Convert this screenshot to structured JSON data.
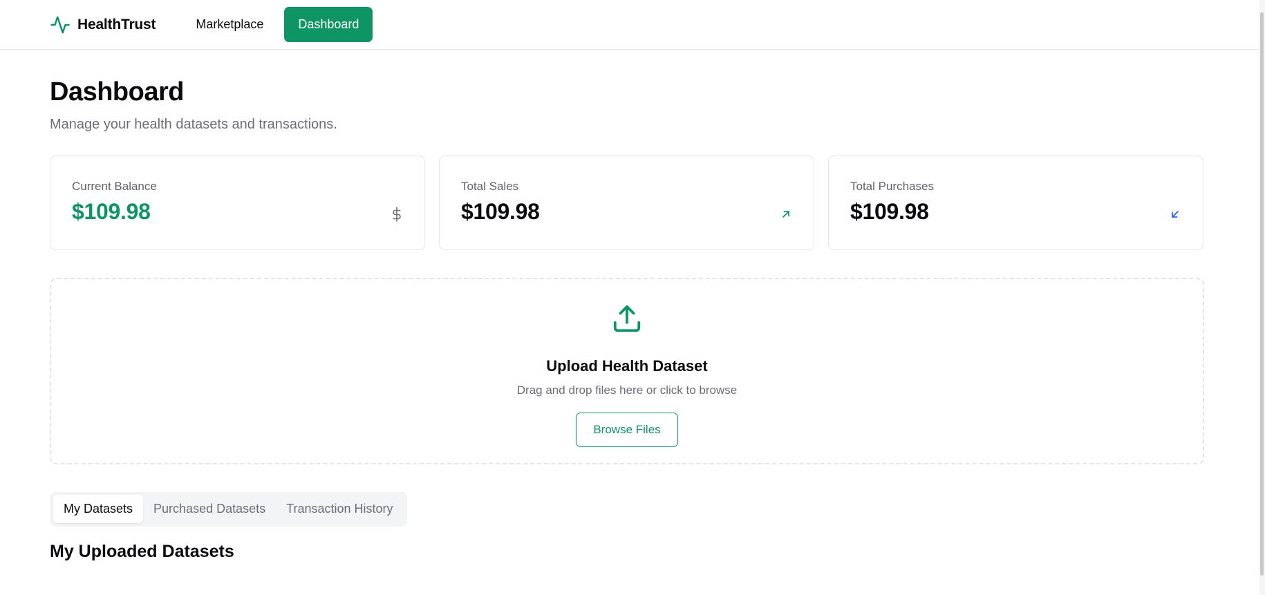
{
  "header": {
    "brand_name": "HealthTrust",
    "nav": [
      {
        "label": "Marketplace",
        "active": false
      },
      {
        "label": "Dashboard",
        "active": true
      }
    ]
  },
  "page": {
    "title": "Dashboard",
    "subtitle": "Manage your health datasets and transactions."
  },
  "stats": [
    {
      "label": "Current Balance",
      "value": "$109.98",
      "icon": "dollar-icon",
      "value_color": "#0f9466"
    },
    {
      "label": "Total Sales",
      "value": "$109.98",
      "icon": "arrow-up-right-icon",
      "icon_color": "#0f9466"
    },
    {
      "label": "Total Purchases",
      "value": "$109.98",
      "icon": "arrow-down-left-icon",
      "icon_color": "#2563eb"
    }
  ],
  "upload": {
    "title": "Upload Health Dataset",
    "hint": "Drag and drop files here or click to browse",
    "button_label": "Browse Files",
    "icon": "upload-icon"
  },
  "tabs": [
    {
      "label": "My Datasets",
      "active": true
    },
    {
      "label": "Purchased Datasets",
      "active": false
    },
    {
      "label": "Transaction History",
      "active": false
    }
  ],
  "section": {
    "title": "My Uploaded Datasets"
  },
  "colors": {
    "brand": "#0f9466",
    "blue_accent": "#2563eb"
  }
}
